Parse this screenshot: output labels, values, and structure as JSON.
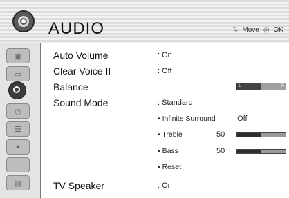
{
  "header": {
    "title": "AUDIO",
    "hint_move": "Move",
    "hint_ok": "OK"
  },
  "sidebar": {
    "items": [
      {
        "icon": "picture-icon",
        "active": false
      },
      {
        "icon": "setup-icon",
        "active": false
      },
      {
        "icon": "audio-icon",
        "active": true
      },
      {
        "icon": "time-icon",
        "active": false
      },
      {
        "icon": "option-icon",
        "active": false
      },
      {
        "icon": "lock-icon",
        "active": false
      },
      {
        "icon": "input-icon",
        "active": false
      },
      {
        "icon": "usb-icon",
        "active": false
      }
    ]
  },
  "menu": {
    "auto_volume": {
      "label": "Auto Volume",
      "value": ": On"
    },
    "clear_voice": {
      "label": "Clear Voice II",
      "value": ": Off"
    },
    "balance": {
      "label": "Balance",
      "left_tag": "L",
      "right_tag": "R",
      "level": 0.5
    },
    "sound_mode": {
      "label": "Sound Mode",
      "value": ": Standard"
    },
    "infinite_surround": {
      "label": "• Infinite Surround",
      "value": ": Off"
    },
    "treble": {
      "label": "• Treble",
      "value": "50",
      "level": 0.5
    },
    "bass": {
      "label": "• Bass",
      "value": "50",
      "level": 0.5
    },
    "reset": {
      "label": "• Reset"
    },
    "tv_speaker": {
      "label": "TV Speaker",
      "value": ": On"
    }
  }
}
